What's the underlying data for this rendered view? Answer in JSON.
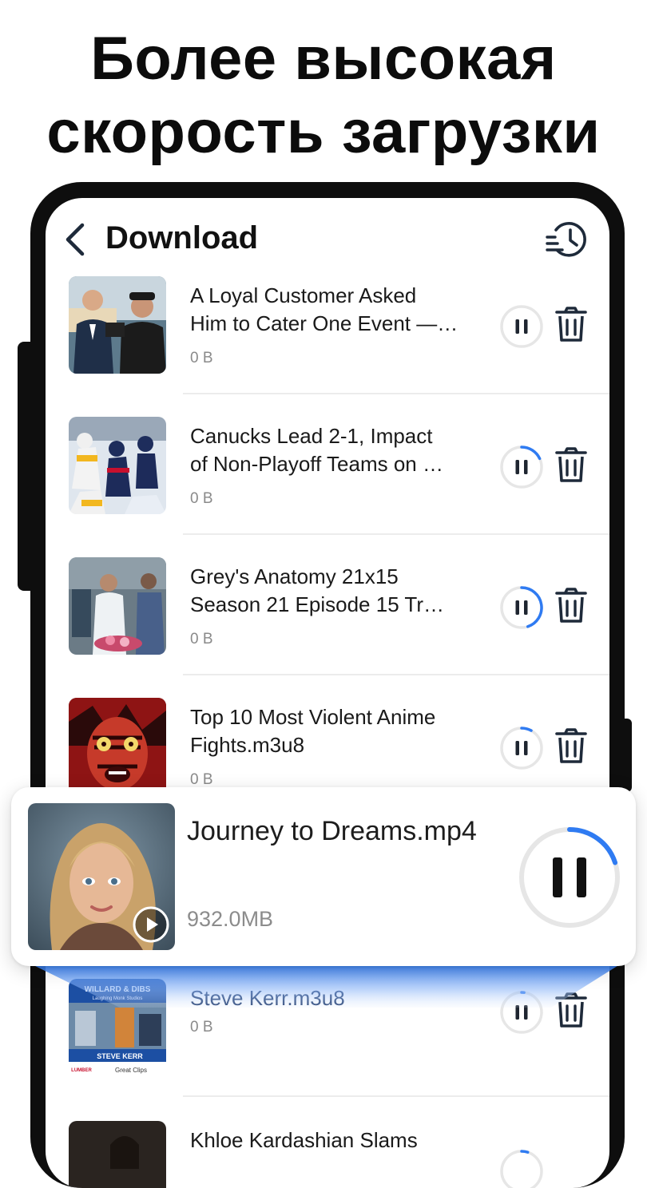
{
  "headline": {
    "line1": "Более высокая",
    "line2": "скорость загрузки"
  },
  "header": {
    "title": "Download",
    "back_icon": "chevron-left-icon",
    "history_icon": "download-history-icon"
  },
  "downloads": [
    {
      "title_line1": "A Loyal Customer Asked",
      "title_line2": "Him to Cater One Event —…",
      "size": "0 B",
      "progress": 0.0
    },
    {
      "title_line1": "Canucks Lead 2-1, Impact",
      "title_line2": "of Non-Playoff Teams on …",
      "size": "0 B",
      "progress": 0.18
    },
    {
      "title_line1": "Grey's Anatomy 21x15",
      "title_line2": "Season 21 Episode 15 Tr…",
      "size": "0 B",
      "progress": 0.45
    },
    {
      "title_line1": "Top 10 Most Violent Anime",
      "title_line2": "Fights.m3u8",
      "size": "0 B",
      "progress": 0.08
    },
    {
      "title_line1": "Steve Kerr.m3u8",
      "title_line2": "",
      "size": "0 B",
      "progress": 0.02
    },
    {
      "title_line1": "Khloe Kardashian Slams",
      "title_line2": "",
      "size": "",
      "progress": 0.05
    }
  ],
  "thumb5_texts": {
    "top": "WILLARD & DIBS",
    "sub": "Laughing Monk Studios",
    "banner": "STEVE KERR",
    "sponsor": "Great Clips",
    "lumber": "LUMBER"
  },
  "featured": {
    "title": "Journey to Dreams.mp4",
    "size": "932.0MB",
    "progress": 0.2,
    "play_icon": "play-icon"
  },
  "colors": {
    "accent": "#2f7bf2",
    "ring_track": "#e6e6e6",
    "pause_bars": "#1e2530",
    "icon_dark": "#1e2a3a"
  }
}
